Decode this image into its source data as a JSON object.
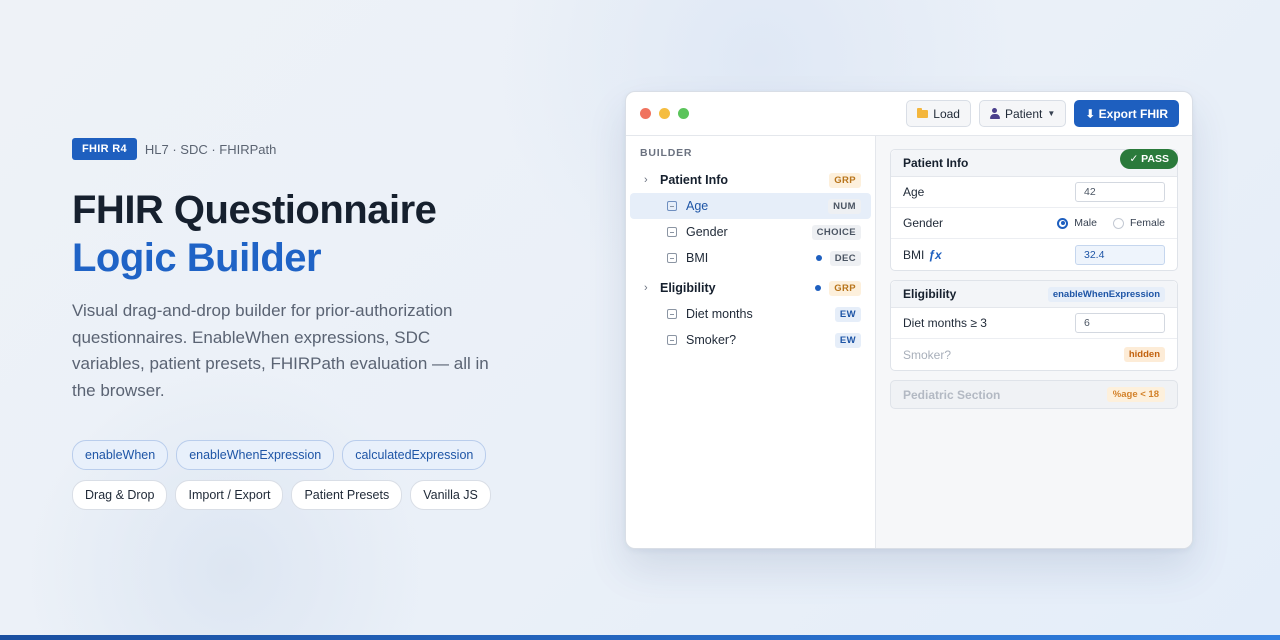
{
  "hero": {
    "badge": "FHIR R4",
    "eyebrow": "HL7 · SDC · FHIRPath",
    "title_line1": "FHIR Questionnaire",
    "title_line2": "Logic Builder",
    "lead": "Visual drag-and-drop builder for prior-authorization questionnaires. EnableWhen expressions, SDC variables, patient presets, FHIRPath evaluation — all in the browser.",
    "chips_primary": [
      "enableWhen",
      "enableWhenExpression",
      "calculatedExpression"
    ],
    "chips_secondary": [
      "Drag & Drop",
      "Import / Export",
      "Patient Presets",
      "Vanilla JS"
    ]
  },
  "toolbar": {
    "load": "Load",
    "patient": "Patient",
    "export": "⬇ Export FHIR"
  },
  "builder": {
    "heading": "BUILDER",
    "groups": [
      {
        "label": "Patient Info",
        "tag": "GRP",
        "dot": false,
        "items": [
          {
            "label": "Age",
            "tag": "NUM",
            "dot": false,
            "selected": true
          },
          {
            "label": "Gender",
            "tag": "CHOICE",
            "dot": false,
            "selected": false
          },
          {
            "label": "BMI",
            "tag": "DEC",
            "dot": true,
            "selected": false
          }
        ]
      },
      {
        "label": "Eligibility",
        "tag": "GRP",
        "dot": true,
        "items": [
          {
            "label": "Diet months",
            "tag": "EW",
            "dot": false,
            "selected": false
          },
          {
            "label": "Smoker?",
            "tag": "EW",
            "dot": false,
            "selected": false
          }
        ]
      }
    ]
  },
  "preview": {
    "patient_info": {
      "title": "Patient Info",
      "status": "✓ PASS",
      "age_label": "Age",
      "age_value": "42",
      "gender_label": "Gender",
      "gender_options": [
        "Male",
        "Female"
      ],
      "gender_selected": "Male",
      "bmi_label": "BMI",
      "bmi_fx": "ƒx",
      "bmi_value": "32.4"
    },
    "eligibility": {
      "title": "Eligibility",
      "tag": "enableWhenExpression",
      "diet_label": "Diet months ≥ 3",
      "diet_value": "6",
      "smoker_label": "Smoker?",
      "smoker_tag": "hidden"
    },
    "pediatric": {
      "title": "Pediatric Section",
      "condition": "%age < 18"
    }
  }
}
